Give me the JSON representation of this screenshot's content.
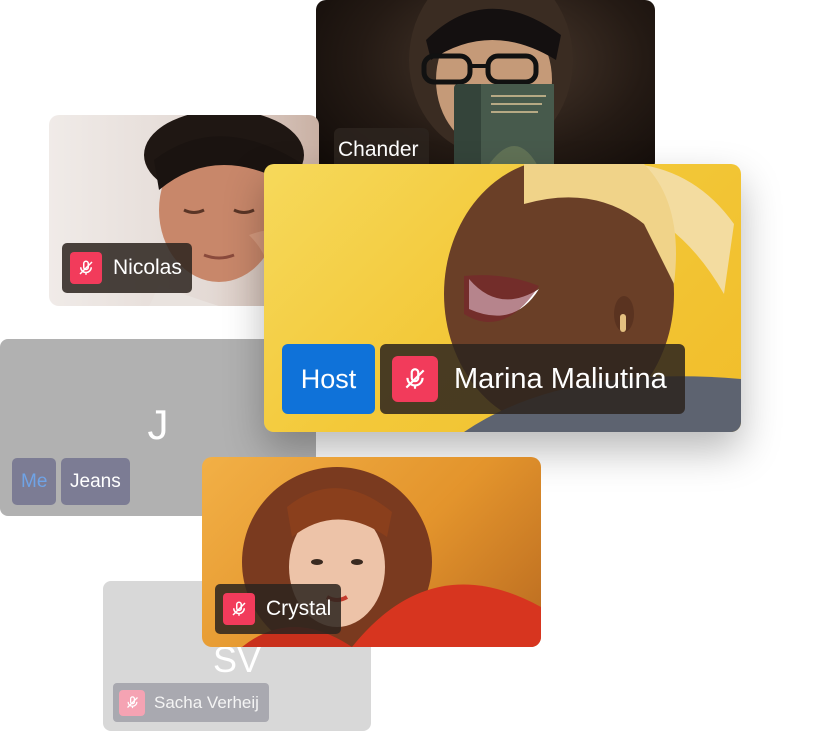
{
  "participants": {
    "chander": {
      "name": "Chander"
    },
    "nicolas": {
      "name": "Nicolas",
      "muted": true
    },
    "marina": {
      "name": "Marina Maliutina",
      "role_badge": "Host",
      "muted": true
    },
    "jeans": {
      "name": "Jeans",
      "initials": "J",
      "me_badge": "Me"
    },
    "crystal": {
      "name": "Crystal",
      "muted": true
    },
    "sacha": {
      "name": "Sacha Verheij",
      "initials": "SV",
      "muted": true
    }
  },
  "colors": {
    "mute_red": "#f23b5b",
    "host_blue": "#0f72d9",
    "chip_dark": "#2c241e",
    "me_text": "#6fa3e6"
  },
  "icons": {
    "mute": "microphone-slash-icon"
  }
}
